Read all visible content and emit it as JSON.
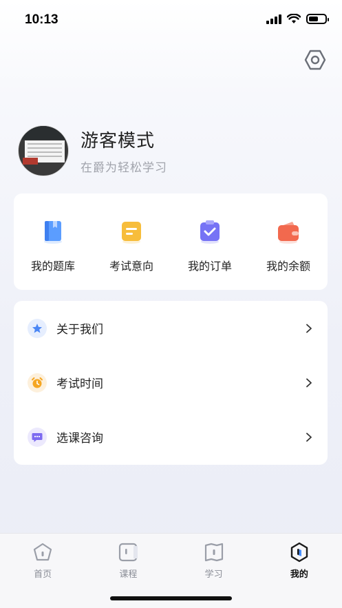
{
  "status_bar": {
    "time": "10:13",
    "battery_level": 0.6
  },
  "header": {
    "settings_icon": "hexagon-settings-icon"
  },
  "profile": {
    "name": "游客模式",
    "subtitle": "在爵为轻松学习"
  },
  "quick_actions": [
    {
      "label": "我的题库",
      "icon": "book-icon",
      "color": "#4a90ff"
    },
    {
      "label": "考试意向",
      "icon": "note-icon",
      "color": "#f5b731"
    },
    {
      "label": "我的订单",
      "icon": "clipboard-check-icon",
      "color": "#6f6cf2"
    },
    {
      "label": "我的余额",
      "icon": "wallet-icon",
      "color": "#f06a4f"
    }
  ],
  "menu": [
    {
      "label": "关于我们",
      "icon": "star-icon",
      "color": "#4a86f5",
      "bg": "#e6eefe"
    },
    {
      "label": "考试时间",
      "icon": "alarm-clock-icon",
      "color": "#f5a623",
      "bg": "#fdf0dc"
    },
    {
      "label": "选课咨询",
      "icon": "chat-bubble-icon",
      "color": "#7d6bf0",
      "bg": "#ece9fd"
    }
  ],
  "tabs": [
    {
      "label": "首页",
      "icon": "home-pentagon-icon",
      "active": false
    },
    {
      "label": "课程",
      "icon": "course-icon",
      "active": false
    },
    {
      "label": "学习",
      "icon": "map-book-icon",
      "active": false
    },
    {
      "label": "我的",
      "icon": "profile-hexagon-icon",
      "active": true
    }
  ]
}
